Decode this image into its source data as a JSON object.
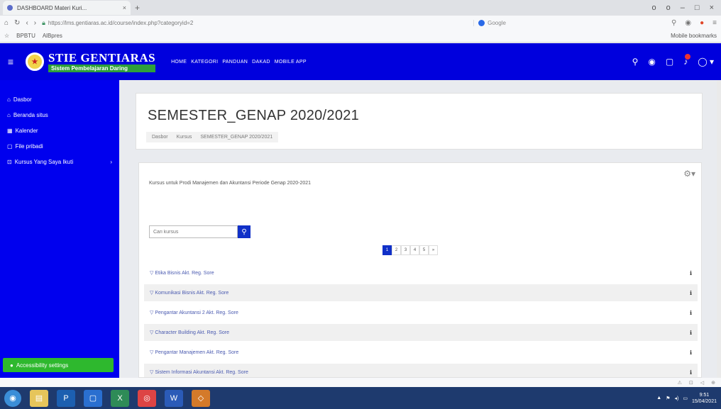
{
  "browser": {
    "tab_title": "DASHBOARD Materi Kuri...",
    "tab_close": "×",
    "new_tab": "+",
    "window_controls": [
      "o",
      "o",
      "–",
      "□",
      "×"
    ],
    "url": "https://lms.gentiaras.ac.id/course/index.php?categoryid=2",
    "search_engine_label": "Google",
    "bookmarks": [
      "BPBTU",
      "AlBpres"
    ],
    "bookmarks_right": "Mobile bookmarks"
  },
  "navbar": {
    "logo_seal": "★",
    "logo_title": "STIE GENTIARAS",
    "logo_subtitle": "Sistem Pembelajaran Daring",
    "links": [
      "HOME",
      "KATEGORI",
      "PANDUAN",
      "DAKAD",
      "MOBILE APP"
    ]
  },
  "sidebar": {
    "items": [
      {
        "icon": "⌂",
        "label": "Dasbor"
      },
      {
        "icon": "⌂",
        "label": "Beranda situs"
      },
      {
        "icon": "▦",
        "label": "Kalender"
      },
      {
        "icon": "▢",
        "label": "File pribadi"
      },
      {
        "icon": "⊡",
        "label": "Kursus Yang Saya Ikuti",
        "chevron": "›"
      }
    ],
    "accessibility": "Accessibility settings"
  },
  "main": {
    "title": "SEMESTER_GENAP 2020/2021",
    "breadcrumb": [
      "Dasbor",
      "Kursus",
      "SEMESTER_GENAP 2020/2021"
    ],
    "summary": "Kursus untuk Prodi Manajemen dan Akuntansi Periode Genap 2020-2021",
    "search_placeholder": "Cari kursus",
    "pages": [
      "1",
      "2",
      "3",
      "4",
      "5",
      "»"
    ],
    "courses": [
      "Etika Bisnis Akt. Reg. Sore",
      "Komunikasi Bisnis Akt. Reg. Sore",
      "Pengantar Akuntansi 2 Akt. Reg. Sore",
      "Character Building Akt. Reg. Sore",
      "Pengantar Manajemen Akt. Reg. Sore",
      "Sistem Informasi Akuntansi Akt. Reg. Sore"
    ]
  },
  "taskbar": {
    "apps": [
      {
        "label": "◉",
        "color": "#3b8ed8"
      },
      {
        "label": "▤",
        "color": "#e6c55b"
      },
      {
        "label": "P",
        "color": "#1c5fb0"
      },
      {
        "label": "▢",
        "color": "#2a6fd0"
      },
      {
        "label": "X",
        "color": "#2e8b57"
      },
      {
        "label": "◎",
        "color": "#d44"
      },
      {
        "label": "W",
        "color": "#2b5bb8"
      },
      {
        "label": "◇",
        "color": "#d47a2a"
      }
    ],
    "time": "9:51",
    "date": "15/04/2021"
  },
  "colors": {
    "primary": "#0000dd",
    "accent_green": "#2eb82e",
    "link": "#4a5ab0"
  }
}
